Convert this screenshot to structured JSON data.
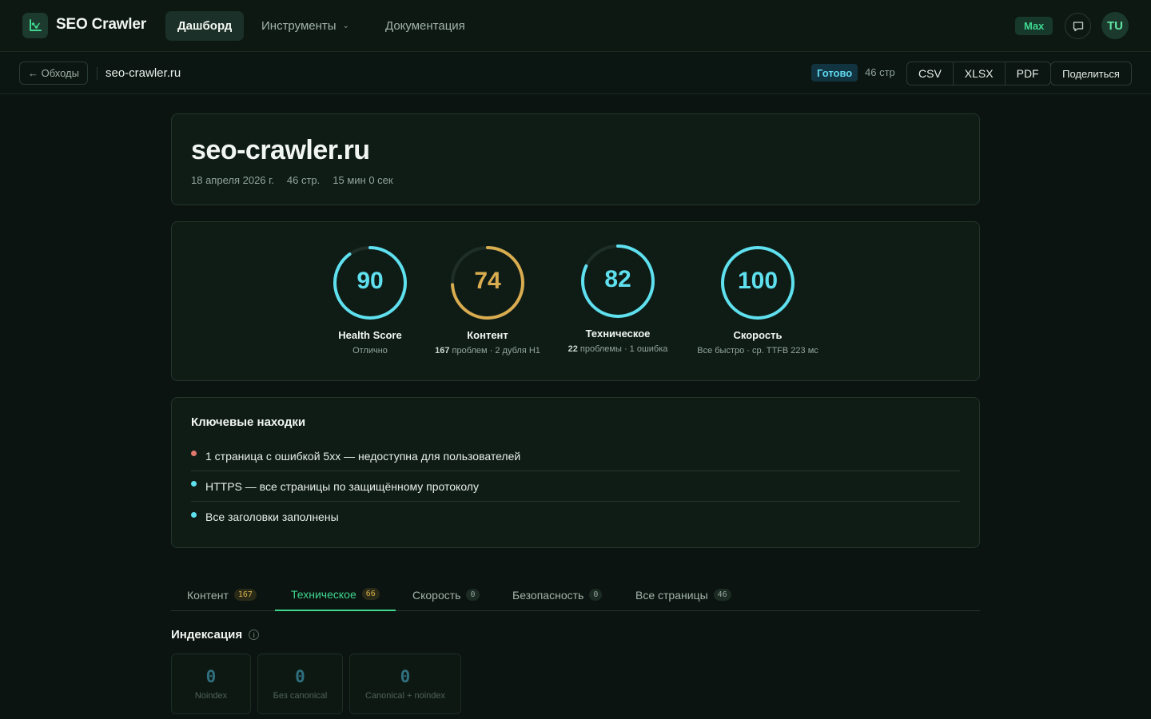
{
  "app": {
    "name": "SEO Crawler"
  },
  "nav": {
    "items": [
      {
        "label": "Дашборд"
      },
      {
        "label": "Инструменты"
      },
      {
        "label": "Документация"
      }
    ],
    "plan": "Max",
    "avatar_initials": "TU"
  },
  "subbar": {
    "back_label": "← Обходы",
    "domain": "seo-crawler.ru",
    "status": "Готово",
    "pages": "46 стр",
    "exports": [
      "CSV",
      "XLSX",
      "PDF"
    ],
    "share": "Поделиться"
  },
  "hero": {
    "title": "seo-crawler.ru",
    "date": "18 апреля 2026 г.",
    "pages": "46 стр.",
    "duration": "15 мин 0 сек"
  },
  "scores": [
    {
      "value": "90",
      "label": "Health Score",
      "sub_strong": "",
      "sub": "Отлично",
      "fraction": 0.9,
      "color": "#5fe0ef"
    },
    {
      "value": "74",
      "label": "Контент",
      "sub_strong": "167",
      "sub": " проблем · 2 дубля H1",
      "fraction": 0.74,
      "color": "#d9ad4f"
    },
    {
      "value": "82",
      "label": "Техническое",
      "sub_strong": "22",
      "sub": " проблемы · 1 ошибка",
      "fraction": 0.82,
      "color": "#5fe0ef"
    },
    {
      "value": "100",
      "label": "Скорость",
      "sub_strong": "",
      "sub": "Все быстро · ср. TTFB 223 мс",
      "fraction": 1.0,
      "color": "#5fe0ef"
    }
  ],
  "findings": {
    "title": "Ключевые находки",
    "items": [
      {
        "text": "1 страница с ошибкой 5xx — недоступна для пользователей",
        "color": "#e0786e"
      },
      {
        "text": "HTTPS — все страницы по защищённому протоколу",
        "color": "#5fe0ef"
      },
      {
        "text": "Все заголовки заполнены",
        "color": "#5fe0ef"
      }
    ]
  },
  "tabs": [
    {
      "label": "Контент",
      "count": "167"
    },
    {
      "label": "Техническое",
      "count": "66"
    },
    {
      "label": "Скорость",
      "count": "0"
    },
    {
      "label": "Безопасность",
      "count": "0"
    },
    {
      "label": "Все страницы",
      "count": "46"
    }
  ],
  "indexing": {
    "title": "Индексация",
    "stats": [
      {
        "value": "0",
        "label": "Noindex"
      },
      {
        "value": "0",
        "label": "Без canonical"
      },
      {
        "value": "0",
        "label": "Canonical + noindex"
      }
    ]
  }
}
